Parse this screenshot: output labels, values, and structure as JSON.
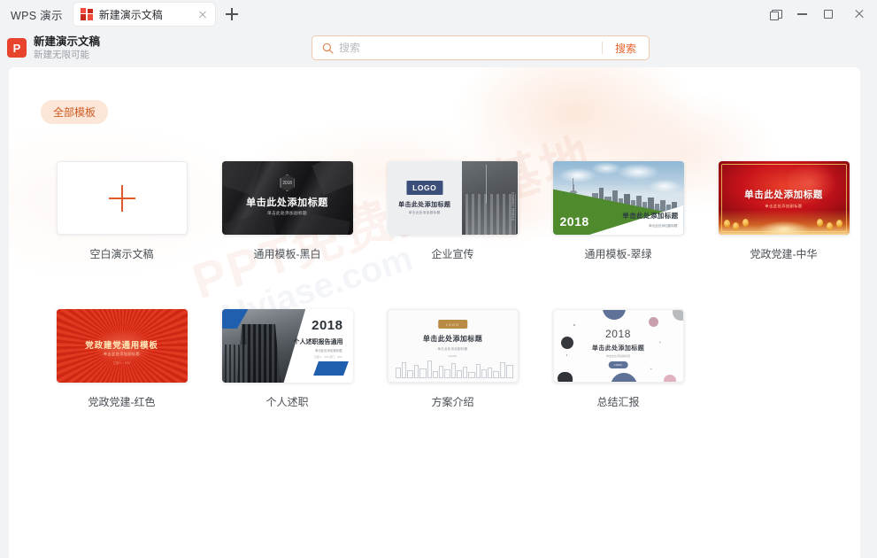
{
  "titlebar": {
    "app_name": "WPS 演示",
    "tab": {
      "label": "新建演示文稿",
      "icon": "wps-presentation-icon",
      "close_icon": "close-icon"
    },
    "new_tab_icon": "plus-icon",
    "window_controls": [
      {
        "name": "cascade-windows-button",
        "icon": "cascade-windows-icon"
      },
      {
        "name": "minimize-button",
        "icon": "minimize-icon"
      },
      {
        "name": "maximize-button",
        "icon": "maximize-icon"
      },
      {
        "name": "close-window-button",
        "icon": "close-icon"
      }
    ]
  },
  "header": {
    "logo_letter": "P",
    "title": "新建演示文稿",
    "subtitle": "新建无限可能"
  },
  "search": {
    "icon": "search-icon",
    "placeholder": "搜索",
    "value": "",
    "button_label": "搜索"
  },
  "filters": {
    "all_templates_label": "全部模板"
  },
  "watermark": {
    "text_cn": "PPT免费资源基地",
    "text_en": "Hyiase.com"
  },
  "colors": {
    "accent": "#e8622b",
    "brand_red": "#e8432c",
    "chip_bg": "#fbe6d8",
    "chip_text": "#cf5b24",
    "panel_bg": "#ffffff",
    "window_bg": "#f2f3f5"
  },
  "templates": [
    {
      "name": "blank-presentation",
      "caption": "空白演示文稿",
      "kind": "blank",
      "plus_icon": "plus-icon"
    },
    {
      "name": "general-template-black-white",
      "caption": "通用模板-黑白",
      "kind": "dark-polygon",
      "slide_title": "单击此处添加标题",
      "slide_subtitle": "单击此处添加副标题",
      "badge_year": "2018"
    },
    {
      "name": "corporate-promotion",
      "caption": "企业宣传",
      "kind": "corporate",
      "logo_text": "LOGO",
      "slide_title": "单击此处添加标题",
      "slide_subtitle": "单击此处添加副标题",
      "side_text": "COMPANY PROFILE"
    },
    {
      "name": "general-template-emerald",
      "caption": "通用模板-翠绿",
      "kind": "green-city",
      "year": "2018",
      "slide_title": "单击此处添加标题",
      "slide_subtitle": "单击此处添加副标题"
    },
    {
      "name": "party-building-china",
      "caption": "党政党建-中华",
      "kind": "red-china",
      "slide_title": "单击此处添加标题",
      "slide_subtitle": "单击此处添加副标题"
    },
    {
      "name": "party-building-red",
      "caption": "党政党建-红色",
      "kind": "red-rays",
      "slide_title": "党政建党通用模板",
      "slide_subtitle": "单击此处添加副标题",
      "slide_note": "汇报人：XXX"
    },
    {
      "name": "personal-report",
      "caption": "个人述职",
      "kind": "personal-report",
      "year": "2018",
      "slide_title": "个人述职报告通用",
      "slide_subtitle": "单击此处添加副标题",
      "slide_note": "汇报人：XXX  部门：XXX"
    },
    {
      "name": "plan-introduction",
      "caption": "方案介绍",
      "kind": "plan-intro",
      "logo_text": "LOGO",
      "slide_title": "单击此处添加标题",
      "slide_subtitle": "单击此处添加副标题",
      "slide_note": "2019/01"
    },
    {
      "name": "summary-report",
      "caption": "总结汇报",
      "kind": "summary",
      "year": "2018",
      "slide_title": "单击此处添加标题",
      "slide_subtitle": "单击此处添加副标题",
      "pill_label": "LOGO"
    }
  ]
}
